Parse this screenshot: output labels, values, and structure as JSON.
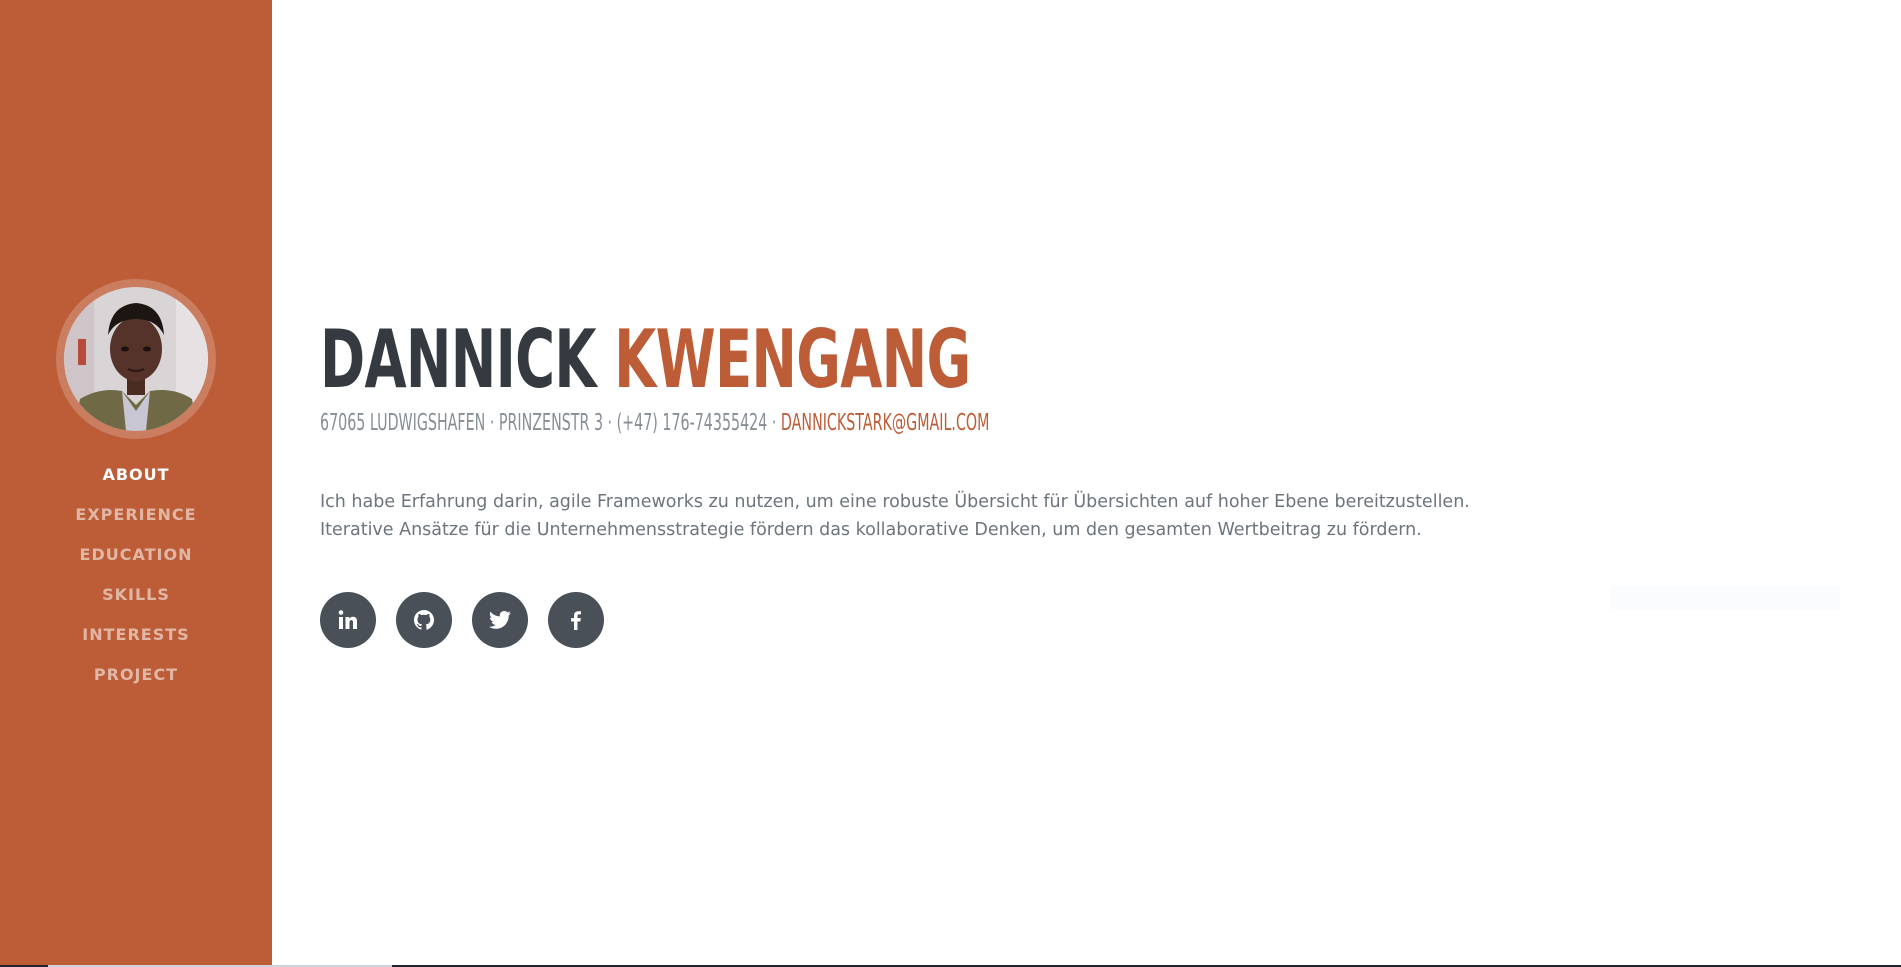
{
  "profile": {
    "first_name": "DANNICK",
    "last_name": "KWENGANG",
    "address": "67065 LUDWIGSHAFEN · PRINZENSTR 3 · (+47) 176-74355424 · ",
    "email": "DANNICKSTARK@GMAIL.COM",
    "bio_line1": "Ich habe Erfahrung darin, agile Frameworks zu nutzen, um eine robuste Übersicht für Übersichten auf hoher Ebene bereitzustellen.",
    "bio_line2": "Iterative Ansätze für die Unternehmensstrategie fördern das kollaborative Denken, um den gesamten Wertbeitrag zu fördern."
  },
  "sidebar": {
    "items": [
      {
        "label": "ABOUT",
        "active": true
      },
      {
        "label": "EXPERIENCE",
        "active": false
      },
      {
        "label": "EDUCATION",
        "active": false
      },
      {
        "label": "SKILLS",
        "active": false
      },
      {
        "label": "INTERESTS",
        "active": false
      },
      {
        "label": "PROJECT",
        "active": false
      }
    ]
  },
  "socials": [
    {
      "icon": "linkedin-icon"
    },
    {
      "icon": "github-icon"
    },
    {
      "icon": "twitter-icon"
    },
    {
      "icon": "facebook-icon"
    }
  ],
  "colors": {
    "accent": "#bd5d38",
    "heading": "#343a40",
    "muted": "#868e96",
    "social_bg": "#495057"
  }
}
